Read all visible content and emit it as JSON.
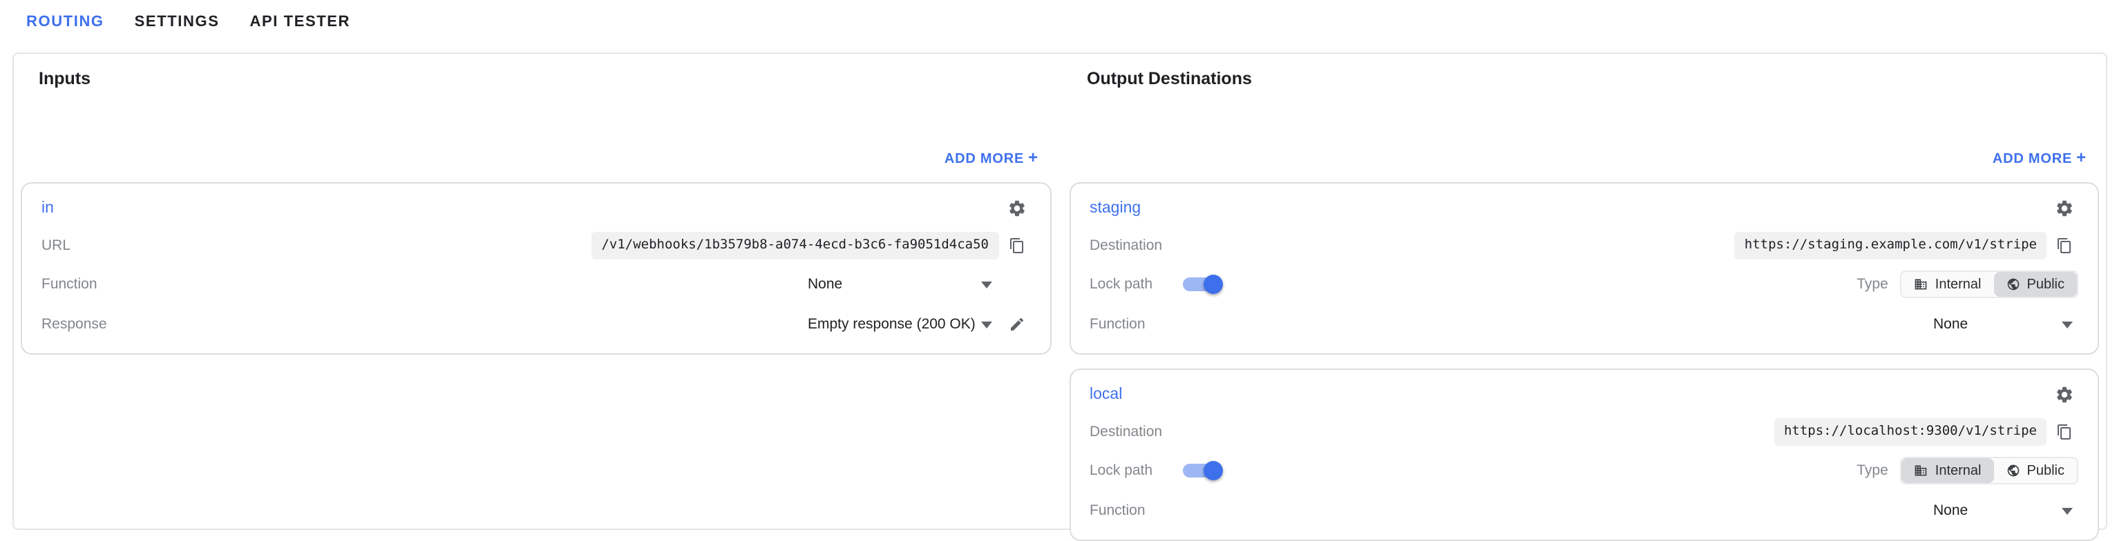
{
  "theme": {
    "accent": "#3e70ec",
    "accent_track": "#9db7f4",
    "text_dark": "#202124",
    "text_gray": "#82868b",
    "chip_bg": "#f1f1f2",
    "card_border": "#dcdddf",
    "panel_border": "#e5e5e6",
    "segment_selected_bg": "#d8dadd",
    "segment_unselected_bg": "#fafafa"
  },
  "tabs": {
    "routing": "ROUTING",
    "settings": "SETTINGS",
    "api_tester": "API TESTER"
  },
  "inputs": {
    "heading": "Inputs",
    "add_more": {
      "label": "ADD MORE",
      "icon": "+"
    },
    "card": {
      "title": "in",
      "url": {
        "label": "URL",
        "value": "/v1/webhooks/1b3579b8-a074-4ecd-b3c6-fa9051d4ca50"
      },
      "function": {
        "label": "Function",
        "value": "None"
      },
      "response": {
        "label": "Response",
        "value": "Empty response (200 OK)"
      }
    }
  },
  "outputs": {
    "heading": "Output Destinations",
    "add_more": {
      "label": "ADD MORE",
      "icon": "+"
    },
    "cards": [
      {
        "title": "staging",
        "destination": {
          "label": "Destination",
          "value": "https://staging.example.com/v1/stripe"
        },
        "lock_path": {
          "label": "Lock path",
          "enabled": true
        },
        "type": {
          "label": "Type",
          "options": [
            "Internal",
            "Public"
          ],
          "selected": "Public"
        },
        "function": {
          "label": "Function",
          "value": "None"
        }
      },
      {
        "title": "local",
        "destination": {
          "label": "Destination",
          "value": "https://localhost:9300/v1/stripe"
        },
        "lock_path": {
          "label": "Lock path",
          "enabled": true
        },
        "type": {
          "label": "Type",
          "options": [
            "Internal",
            "Public"
          ],
          "selected": "Internal"
        },
        "function": {
          "label": "Function",
          "value": "None"
        }
      }
    ]
  }
}
